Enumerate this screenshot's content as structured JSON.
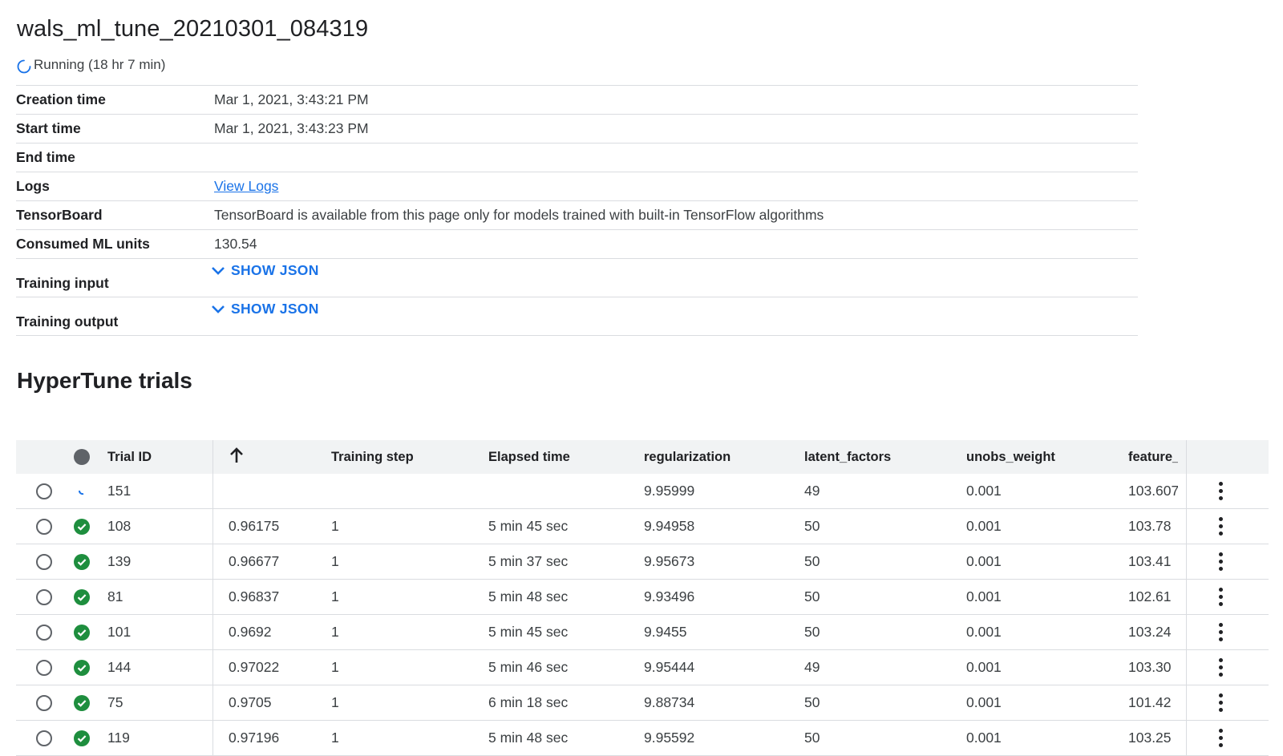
{
  "job": {
    "title": "wals_ml_tune_20210301_084319",
    "status": "Running (18 hr 7 min)"
  },
  "details": [
    {
      "label": "Creation time",
      "value": "Mar 1, 2021, 3:43:21 PM"
    },
    {
      "label": "Start time",
      "value": "Mar 1, 2021, 3:43:23 PM"
    },
    {
      "label": "End time",
      "value": ""
    },
    {
      "label": "Logs",
      "value": "View Logs"
    },
    {
      "label": "TensorBoard",
      "value": "TensorBoard is available from this page only for models trained with built-in TensorFlow algorithms"
    },
    {
      "label": "Consumed ML units",
      "value": "130.54"
    },
    {
      "label": "Training input",
      "value": "SHOW JSON"
    },
    {
      "label": "Training output",
      "value": "SHOW JSON"
    }
  ],
  "trials": {
    "title": "HyperTune trials",
    "columns": {
      "trial_id": "Trial ID",
      "sort_icon": "arrow-up-icon",
      "training_step": "Training step",
      "elapsed_time": "Elapsed time",
      "regularization": "regularization",
      "latent_factors": "latent_factors",
      "unobs_weight": "unobs_weight",
      "feature": "feature_"
    },
    "rows": [
      {
        "status": "running",
        "id": "151",
        "metric": "",
        "step": "",
        "elapsed": "",
        "reg": "9.95999",
        "latent": "49",
        "unobs": "0.001",
        "feature": "103.607"
      },
      {
        "status": "succeeded",
        "id": "108",
        "metric": "0.96175",
        "step": "1",
        "elapsed": "5 min 45 sec",
        "reg": "9.94958",
        "latent": "50",
        "unobs": "0.001",
        "feature": "103.78"
      },
      {
        "status": "succeeded",
        "id": "139",
        "metric": "0.96677",
        "step": "1",
        "elapsed": "5 min 37 sec",
        "reg": "9.95673",
        "latent": "50",
        "unobs": "0.001",
        "feature": "103.41"
      },
      {
        "status": "succeeded",
        "id": "81",
        "metric": "0.96837",
        "step": "1",
        "elapsed": "5 min 48 sec",
        "reg": "9.93496",
        "latent": "50",
        "unobs": "0.001",
        "feature": "102.61"
      },
      {
        "status": "succeeded",
        "id": "101",
        "metric": "0.9692",
        "step": "1",
        "elapsed": "5 min 45 sec",
        "reg": "9.9455",
        "latent": "50",
        "unobs": "0.001",
        "feature": "103.24"
      },
      {
        "status": "succeeded",
        "id": "144",
        "metric": "0.97022",
        "step": "1",
        "elapsed": "5 min 46 sec",
        "reg": "9.95444",
        "latent": "49",
        "unobs": "0.001",
        "feature": "103.30"
      },
      {
        "status": "succeeded",
        "id": "75",
        "metric": "0.9705",
        "step": "1",
        "elapsed": "6 min 18 sec",
        "reg": "9.88734",
        "latent": "50",
        "unobs": "0.001",
        "feature": "101.42"
      },
      {
        "status": "succeeded",
        "id": "119",
        "metric": "0.97196",
        "step": "1",
        "elapsed": "5 min 48 sec",
        "reg": "9.95592",
        "latent": "50",
        "unobs": "0.001",
        "feature": "103.25"
      }
    ]
  },
  "colors": {
    "accent": "#1a73e8",
    "success": "#1e8e3e",
    "divider": "#dadce0",
    "header_bg": "#f1f3f4"
  }
}
